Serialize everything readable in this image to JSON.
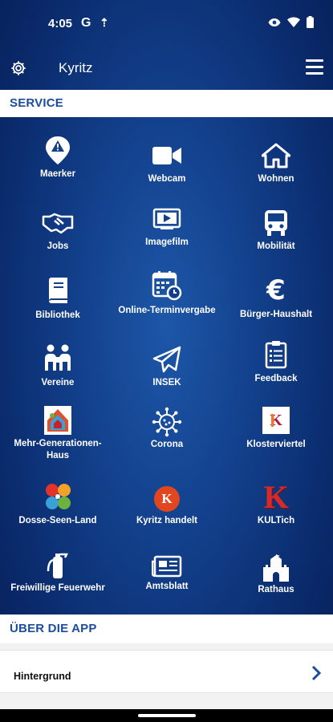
{
  "status": {
    "time": "4:05",
    "g_glyph": "G",
    "upload_glyph": "⇡"
  },
  "appbar": {
    "title": "Kyritz"
  },
  "sections": {
    "service": "SERVICE",
    "about": "ÜBER DIE APP"
  },
  "tiles": [
    {
      "label": "Maerker",
      "icon": "alert-pin-icon"
    },
    {
      "label": "Webcam",
      "icon": "video-camera-icon"
    },
    {
      "label": "Wohnen",
      "icon": "house-icon"
    },
    {
      "label": "Jobs",
      "icon": "handshake-icon"
    },
    {
      "label": "Imagefilm",
      "icon": "film-player-icon"
    },
    {
      "label": "Mobilität",
      "icon": "bus-icon"
    },
    {
      "label": "Bibliothek",
      "icon": "book-icon"
    },
    {
      "label": "Online-Terminvergabe",
      "icon": "calendar-clock-icon"
    },
    {
      "label": "Bürger-Haushalt",
      "icon": "euro-icon"
    },
    {
      "label": "Vereine",
      "icon": "people-group-icon"
    },
    {
      "label": "INSEK",
      "icon": "paper-plane-icon"
    },
    {
      "label": "Feedback",
      "icon": "clipboard-icon"
    },
    {
      "label": "Mehr-Generationen-Haus",
      "icon": "generations-house-logo"
    },
    {
      "label": "Corona",
      "icon": "virus-icon"
    },
    {
      "label": "Klosterviertel",
      "icon": "klosterviertel-logo"
    },
    {
      "label": "Dosse-Seen-Land",
      "icon": "dosse-seen-land-logo"
    },
    {
      "label": "Kyritz handelt",
      "icon": "kyritz-handelt-logo"
    },
    {
      "label": "KULTich",
      "icon": "kultich-logo"
    },
    {
      "label": "Freiwillige Feuerwehr",
      "icon": "fire-extinguisher-icon"
    },
    {
      "label": "Amtsblatt",
      "icon": "newspaper-icon"
    },
    {
      "label": "Rathaus",
      "icon": "castle-icon"
    }
  ],
  "about": {
    "items": [
      {
        "label": "Hintergrund"
      }
    ]
  },
  "logo_text": {
    "kyritz_handelt": "K",
    "kultich": "K",
    "klosterviertel": "K"
  },
  "colors": {
    "accent": "#1b4d9c",
    "bg_dark": "#0a2a6b",
    "bg_mid": "#1d57a8",
    "white": "#ffffff"
  }
}
